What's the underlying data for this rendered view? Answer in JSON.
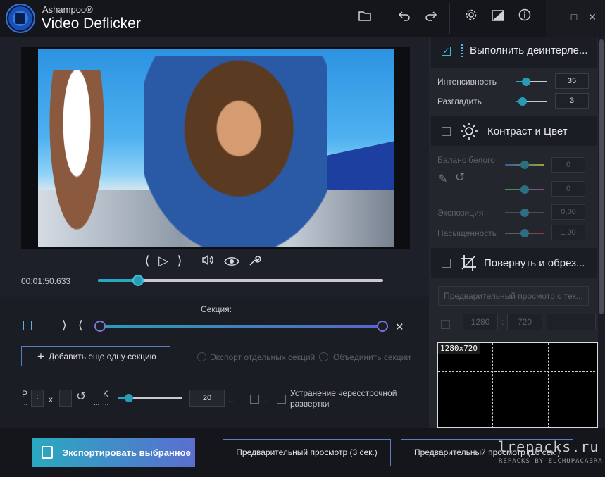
{
  "app": {
    "brand": "Ashampoo®",
    "name": "Video Deflicker"
  },
  "player": {
    "timecode": "00:01:50.633",
    "progress": 0.14
  },
  "section": {
    "title": "Секция:",
    "add_button": "Добавить еще одну секцию",
    "export_separate": "Экспорт отдельных секций",
    "merge_sections": "Объединить секции"
  },
  "options": {
    "p_label": "P",
    "p_dots": "...",
    "x_label": "x",
    "k_label": "K",
    "k_dots": "...",
    "mid_dots": "...",
    "value": "20",
    "after_dots": "...",
    "chk_dots": "...",
    "deinterlace_label": "Устранение чересстрочной развертки",
    "slider_value": 0.18
  },
  "bottom": {
    "export_button": "Экспортировать выбранное",
    "preview_button_1": "Предварительный просмотр (3 сек.)",
    "preview_button_2": "Предварительный просмотр (10 сек.)"
  },
  "watermark": {
    "site": "lrepacks.ru",
    "sub": "REPACKS BY ELCHUPACABRA"
  },
  "deinterlace": {
    "title": "Выполнить деинтерле...",
    "intensity_label": "Интенсивность",
    "intensity_value": "35",
    "smooth_label": "Разгладить",
    "smooth_value": "3"
  },
  "contrast": {
    "title": "Контраст и Цвет",
    "white_balance_label": "Баланс белого",
    "wb_value_1": "0",
    "wb_value_2": "0",
    "exposure_label": "Экспозиция",
    "exposure_value": "0,00",
    "saturation_label": "Насыщенность",
    "saturation_value": "1,00"
  },
  "crop": {
    "title": "Повернуть и обрез...",
    "preview_button": "Предварительный просмотр с тек...",
    "dots": "...",
    "width": "1280",
    "sep": ":",
    "height": "720",
    "preview_label": "1280x720"
  },
  "colors": {
    "accent": "#2aa7c0",
    "accent2": "#5a6ed0",
    "bg": "#1e2029",
    "panel": "#24262e"
  }
}
